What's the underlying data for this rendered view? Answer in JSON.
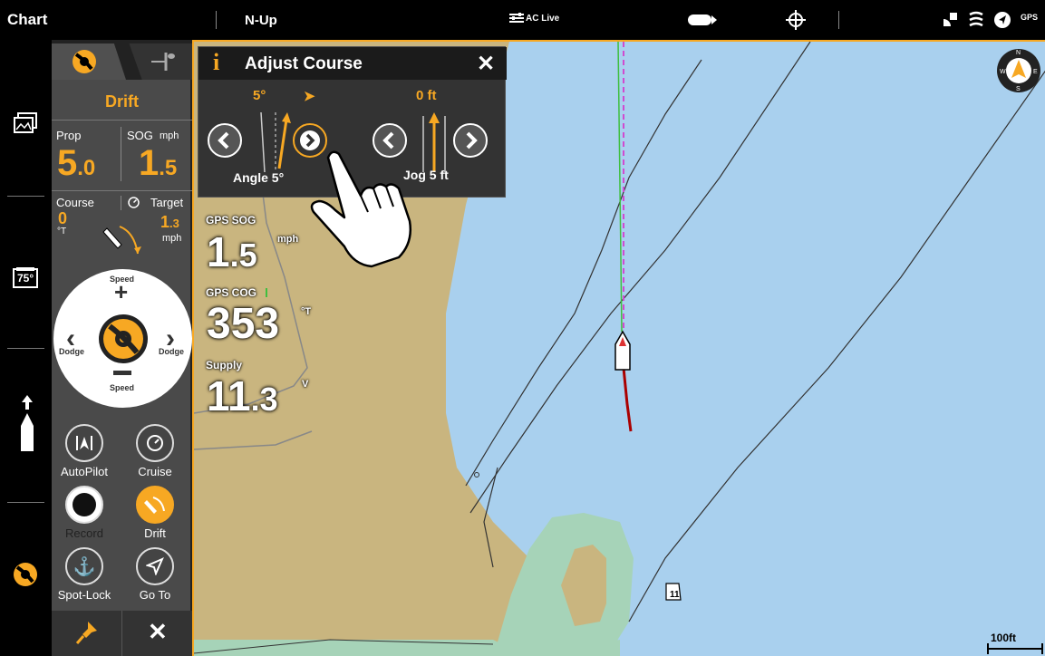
{
  "topbar": {
    "title": "Chart",
    "orientation": "N-Up",
    "ac_live": "AC Live",
    "gps": "GPS"
  },
  "panel": {
    "mode": "Drift",
    "prop_label": "Prop",
    "prop_value_int": "5",
    "prop_value_dec": ".0",
    "sog_label": "SOG",
    "sog_unit": "mph",
    "sog_value_int": "1",
    "sog_value_dec": ".5",
    "course_label": "Course",
    "course_value": "0",
    "course_unit": "°T",
    "target_label": "Target",
    "target_value_int": "1",
    "target_value_dec": ".3",
    "target_unit": "mph",
    "dial": {
      "speed_up": "Speed",
      "speed_down": "Speed",
      "dodge_left": "Dodge",
      "dodge_right": "Dodge"
    },
    "buttons": {
      "autopilot": "AutoPilot",
      "cruise": "Cruise",
      "record": "Record",
      "drift": "Drift",
      "spotlock": "Spot-Lock",
      "goto": "Go To"
    }
  },
  "rail": {
    "temp": "75°"
  },
  "dialog": {
    "title": "Adjust Course",
    "angle_value": "5°",
    "jog_value": "0 ft",
    "angle_label": "Angle 5°",
    "jog_label": "Jog 5 ft"
  },
  "overlay": {
    "gps_sog_label": "GPS SOG",
    "gps_sog_int": "1",
    "gps_sog_dec": ".5",
    "gps_sog_unit": "mph",
    "gps_cog_label": "GPS COG",
    "gps_cog_value": "353",
    "gps_cog_unit": "°T",
    "supply_label": "Supply",
    "supply_int": "11",
    "supply_dec": ".3",
    "supply_unit": "V"
  },
  "map": {
    "buoy_label": "11",
    "scale_label": "100ft",
    "water_color": "#a9d0ee",
    "land_color": "#c9b57f",
    "shallow_color": "#a6d3b8"
  },
  "colors": {
    "accent": "#f7a823"
  }
}
